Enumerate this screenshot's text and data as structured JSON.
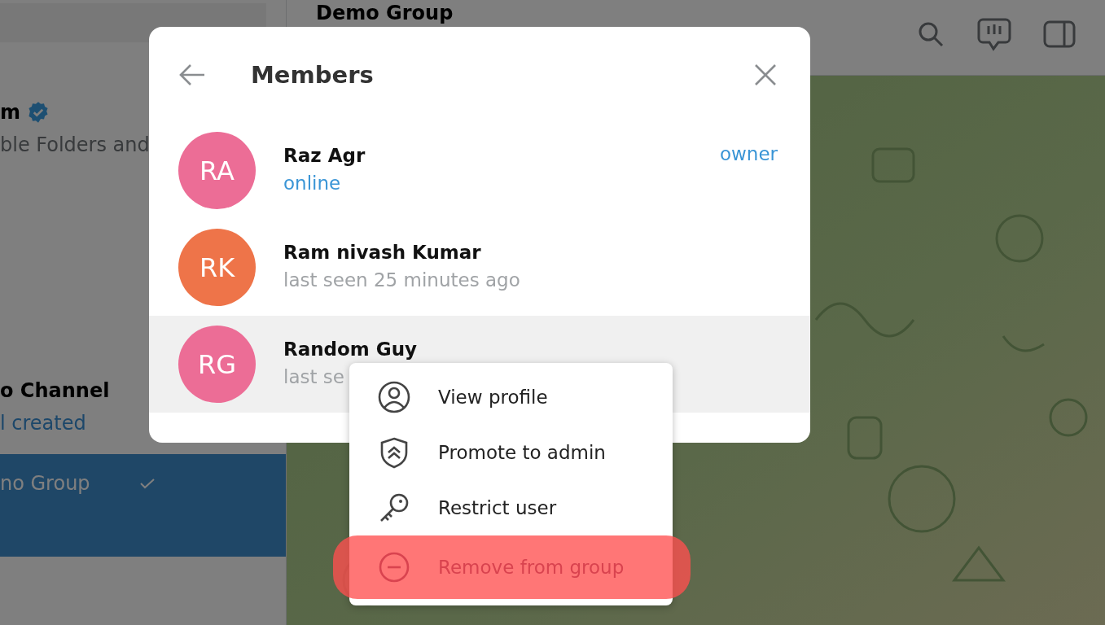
{
  "sidebar": {
    "chats": [
      {
        "name": "m",
        "verified": true,
        "preview": "ble Folders and",
        "preview_accent": false,
        "read": false,
        "selected": false
      },
      {
        "name": "o Channel",
        "verified": false,
        "preview": "l created",
        "preview_accent": true,
        "read": false,
        "selected": false
      },
      {
        "name": "no Group",
        "verified": false,
        "read": true,
        "selected": true
      }
    ]
  },
  "chat_header": {
    "title": "Demo Group"
  },
  "dialog": {
    "title": "Members",
    "members": [
      {
        "initials": "RA",
        "color": "#ec6d96",
        "name": "Raz Agr",
        "status": "online",
        "online": true,
        "role": "owner",
        "selected": false
      },
      {
        "initials": "RK",
        "color": "#ee7449",
        "name": "Ram nivash Kumar",
        "status": "last seen 25 minutes ago",
        "online": false,
        "selected": false
      },
      {
        "initials": "RG",
        "color": "#ec6d96",
        "name": "Random Guy",
        "status": "last se",
        "online": false,
        "selected": true
      }
    ]
  },
  "context_menu": {
    "items": [
      {
        "kind": "profile",
        "label": "View profile",
        "danger": false,
        "highlighted": false
      },
      {
        "kind": "promote",
        "label": "Promote to admin",
        "danger": false,
        "highlighted": false
      },
      {
        "kind": "restrict",
        "label": "Restrict user",
        "danger": false,
        "highlighted": false
      },
      {
        "kind": "remove",
        "label": "Remove from group",
        "danger": true,
        "highlighted": true
      }
    ]
  }
}
